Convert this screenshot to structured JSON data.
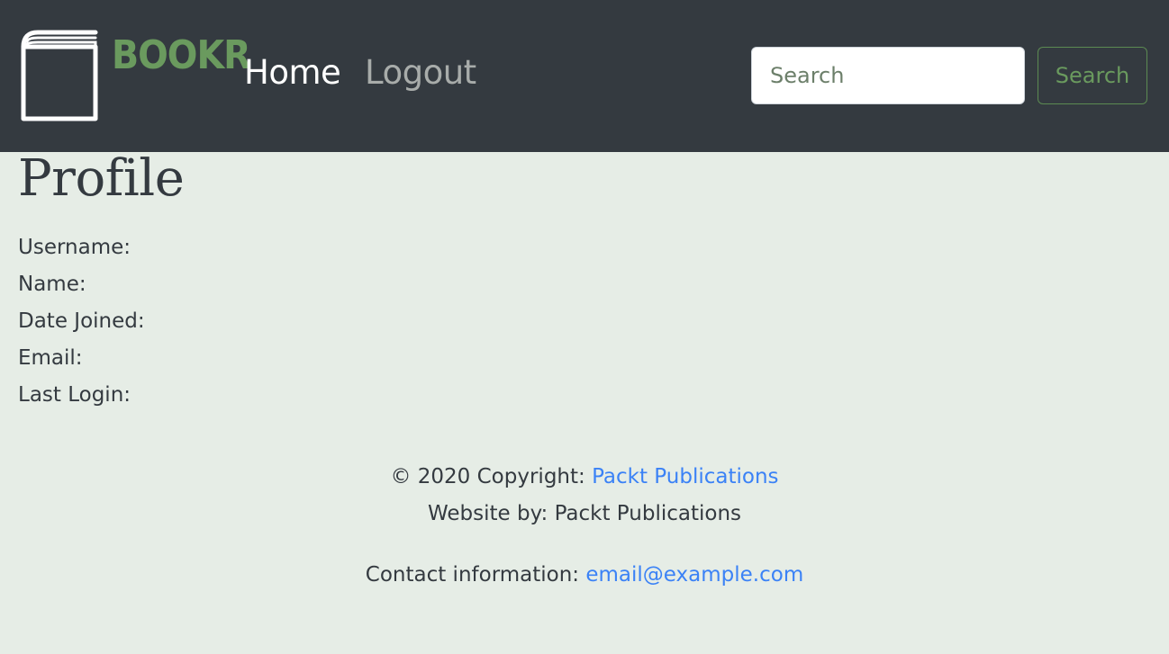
{
  "navbar": {
    "brand": "BOOKR",
    "logo_icon": "book-icon",
    "links": [
      {
        "label": "Home"
      },
      {
        "label": "Logout"
      }
    ],
    "search": {
      "placeholder": "Search",
      "button_label": "Search"
    },
    "colors": {
      "background": "#343a40",
      "brand": "#6a9a5e",
      "active_link": "#ffffff",
      "inactive_link": "#a8acaa",
      "search_button_border": "#5c8a52"
    }
  },
  "main": {
    "title": "Profile",
    "fields": [
      {
        "label": "Username:"
      },
      {
        "label": "Name:"
      },
      {
        "label": "Date Joined:"
      },
      {
        "label": "Email:"
      },
      {
        "label": "Last Login:"
      }
    ],
    "background": "#e6ede6"
  },
  "footer": {
    "copyright_prefix": "© 2020 Copyright: ",
    "copyright_link": "Packt Publications",
    "website_by": "Website by: Packt Publications",
    "contact_prefix": "Contact information: ",
    "contact_email": "email@example.com",
    "link_color": "#3b82f6"
  }
}
